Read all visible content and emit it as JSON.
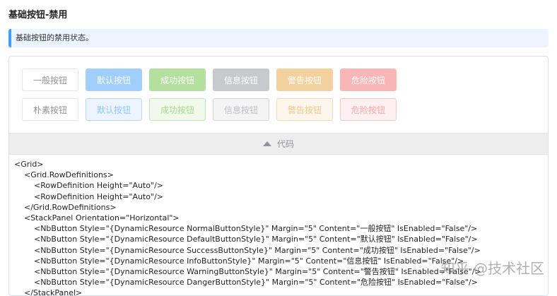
{
  "page": {
    "title": "基础按钮-禁用",
    "tip": "基础按钮的禁用状态。"
  },
  "buttons": {
    "row1": [
      "一般按钮",
      "默认按钮",
      "成功按钮",
      "信息按钮",
      "警告按钮",
      "危险按钮"
    ],
    "row2": [
      "朴素按钮",
      "默认按钮",
      "成功按钮",
      "信息按钮",
      "警告按钮",
      "危险按钮"
    ]
  },
  "code_toggle": {
    "label": "代码",
    "icon": "caret-up-icon"
  },
  "code": [
    "<Grid>",
    "    <Grid.RowDefinitions>",
    "        <RowDefinition Height=\"Auto\"/>",
    "        <RowDefinition Height=\"Auto\"/>",
    "    </Grid.RowDefinitions>",
    "    <StackPanel Orientation=\"Horizontal\">",
    "        <NbButton Style=\"{DynamicResource NormalButtonStyle}\" Margin=\"5\" Content=\"一般按钮\" IsEnabled=\"False\"/>",
    "        <NbButton Style=\"{DynamicResource DefaultButtonStyle}\" Margin=\"5\" Content=\"默认按钮\" IsEnabled=\"False\"/>",
    "        <NbButton Style=\"{DynamicResource SuccessButtonStyle}\" Margin=\"5\" Content=\"成功按钮\" IsEnabled=\"False\"/>",
    "        <NbButton Style=\"{DynamicResource InfoButtonStyle}\" Margin=\"5\" Content=\"信息按钮\" IsEnabled=\"False\"/>",
    "        <NbButton Style=\"{DynamicResource WarningButtonStyle}\" Margin=\"5\" Content=\"警告按钮\" IsEnabled=\"False\"/>",
    "        <NbButton Style=\"{DynamicResource DangerButtonStyle}\" Margin=\"5\" Content=\"危险按钮\" IsEnabled=\"False\"/>",
    "    </StackPanel>"
  ],
  "watermark": "知乎 @技术社区",
  "colors": {
    "primary": "#409eff",
    "success": "#67c23a",
    "info": "#909399",
    "warning": "#e6a23c",
    "danger": "#f56c6c"
  }
}
